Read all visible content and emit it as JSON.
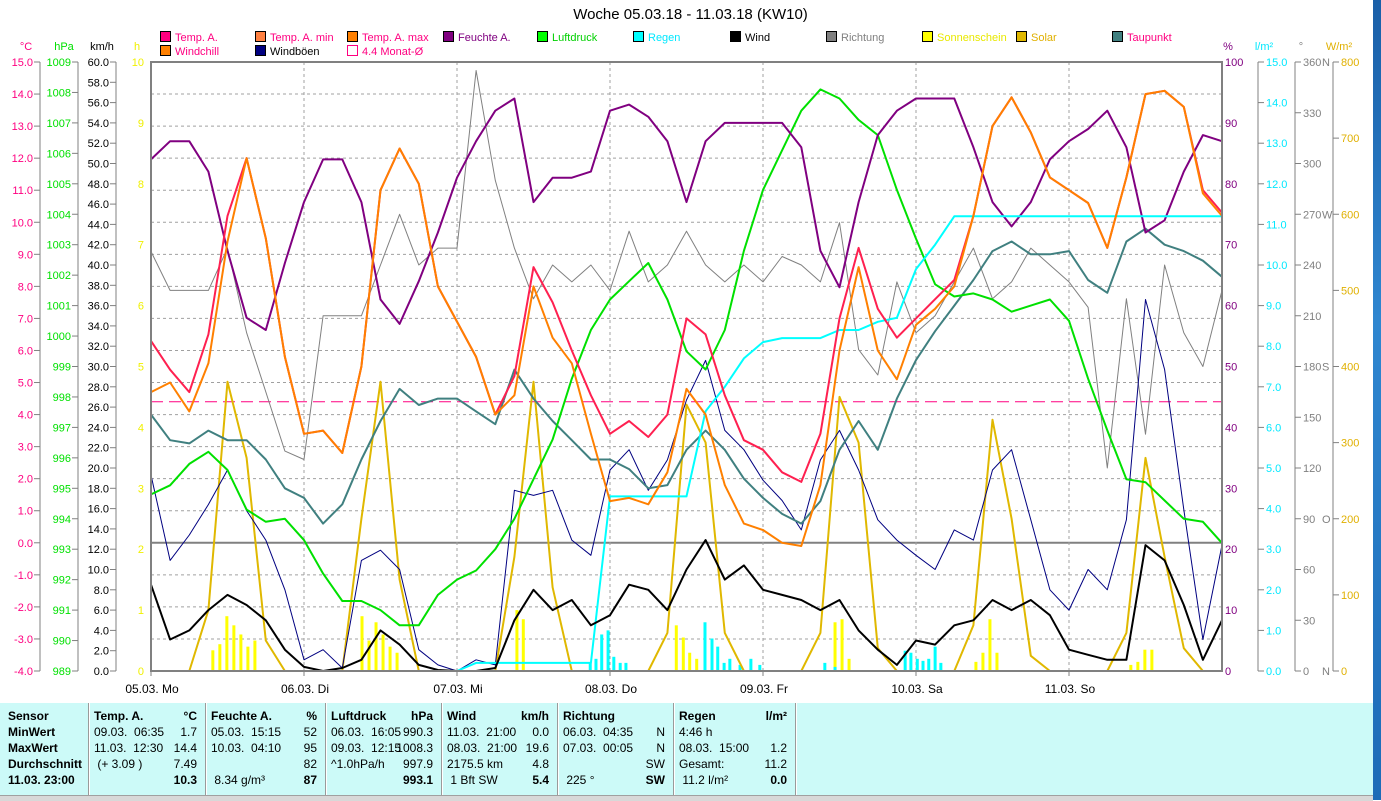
{
  "title": "Woche 05.03.18 - 11.03.18 (KW10)",
  "legend": [
    {
      "label": "Temp. A.",
      "swatch": "#ff0080",
      "text_color": "#ff0080"
    },
    {
      "label": "Temp. A. min",
      "swatch": "#ff8040",
      "text_color": "#ff0080"
    },
    {
      "label": "Temp. A. max",
      "swatch": "#ff8000",
      "text_color": "#ff0080"
    },
    {
      "label": "Feuchte A.",
      "swatch": "#800080",
      "text_color": "#800080"
    },
    {
      "label": "Luftdruck",
      "swatch": "#00ff00",
      "text_color": "#00d000"
    },
    {
      "label": "Regen",
      "swatch": "#00ffff",
      "text_color": "#00e8ff"
    },
    {
      "label": "Wind",
      "swatch": "#000000",
      "text_color": "#000000"
    },
    {
      "label": "Richtung",
      "swatch": "#808080",
      "text_color": "#808080"
    },
    {
      "label": "Sonnenschein",
      "swatch": "#ffff00",
      "text_color": "#e8e800"
    },
    {
      "label": "Solar",
      "swatch": "#e0b800",
      "text_color": "#e0b000"
    },
    {
      "label": "Taupunkt",
      "swatch": "#408080",
      "text_color": "#ff0080"
    },
    {
      "label": "Windchill",
      "swatch": "#ff8000",
      "text_color": "#ff0080"
    },
    {
      "label": "Windböen",
      "swatch": "#000080",
      "text_color": "#000000"
    },
    {
      "label": "4.4 Monat-Ø",
      "swatch": "outline",
      "text_color": "#ff0080"
    }
  ],
  "chart_data": {
    "type": "line",
    "title": "Woche 05.03.18 - 11.03.18 (KW10)",
    "x_start": "05.03.18 00:00",
    "x_step_hours": 3,
    "x_range_hours": [
      0,
      168
    ],
    "x_tick_labels": [
      "05.03.  Mo",
      "06.03.  Di",
      "07.03.  Mi",
      "08.03.  Do",
      "09.03.  Fr",
      "10.03.  Sa",
      "11.03.  So"
    ],
    "grid": true,
    "axes_left": [
      {
        "id": "temp",
        "unit": "°C",
        "min": -4,
        "max": 15,
        "step": 1,
        "decimals": 1,
        "color": "#ff0080"
      },
      {
        "id": "press",
        "unit": "hPa",
        "min": 989,
        "max": 1009,
        "step": 1,
        "decimals": 0,
        "color": "#00e000"
      },
      {
        "id": "wind",
        "unit": "km/h",
        "min": 0,
        "max": 60,
        "step": 2,
        "decimals": 1,
        "color": "#000000"
      },
      {
        "id": "sun",
        "unit": "h",
        "min": 0,
        "max": 10,
        "step": 1,
        "decimals": 0,
        "color": "#f0f000"
      }
    ],
    "axes_right": [
      {
        "id": "hum",
        "unit": "%",
        "min": 0,
        "max": 100,
        "step": 10,
        "decimals": 0,
        "color": "#800080"
      },
      {
        "id": "rain",
        "unit": "l/m²",
        "min": 0,
        "max": 15,
        "step": 1,
        "decimals": 1,
        "color": "#00e8ff"
      },
      {
        "id": "dir",
        "unit": "°",
        "min": 0,
        "max": 360,
        "step": 30,
        "decimals": 0,
        "color": "#808080",
        "compass": {
          "0": "N",
          "90": "O",
          "180": "S",
          "270": "W",
          "360": "N"
        }
      },
      {
        "id": "solar",
        "unit": "W/m²",
        "min": 0,
        "max": 800,
        "step": 100,
        "decimals": 0,
        "color": "#e0b000"
      }
    ],
    "reference_lines": [
      {
        "name": "4.4 Monat-Ø",
        "axis": "temp",
        "value": 4.4,
        "color": "#ff0080"
      }
    ],
    "series": [
      {
        "name": "Richtung",
        "axis": "dir",
        "color": "#808080",
        "width": 1,
        "values": [
          248,
          225,
          225,
          225,
          250,
          200,
          165,
          130,
          125,
          210,
          210,
          210,
          240,
          270,
          240,
          250,
          250,
          355,
          290,
          250,
          220,
          240,
          230,
          240,
          225,
          260,
          230,
          240,
          260,
          240,
          230,
          240,
          230,
          245,
          240,
          230,
          265,
          190,
          175,
          230,
          200,
          210,
          230,
          250,
          220,
          230,
          250,
          240,
          230,
          215,
          120,
          220,
          140,
          240,
          200,
          180,
          225
        ]
      },
      {
        "name": "Solar",
        "axis": "solar",
        "color": "#e0b800",
        "width": 2,
        "values": [
          0,
          0,
          0,
          80,
          380,
          280,
          40,
          0,
          0,
          0,
          0,
          200,
          380,
          120,
          0,
          0,
          0,
          0,
          0,
          150,
          380,
          110,
          0,
          0,
          0,
          0,
          0,
          50,
          350,
          300,
          50,
          0,
          0,
          0,
          0,
          50,
          360,
          300,
          30,
          0,
          0,
          0,
          0,
          60,
          330,
          200,
          20,
          0,
          0,
          0,
          0,
          50,
          280,
          150,
          30,
          0,
          0
        ]
      },
      {
        "name": "Windböen",
        "axis": "wind",
        "color": "#000080",
        "width": 1,
        "values": [
          19.3,
          10.9,
          13.4,
          16.4,
          19.8,
          15.8,
          12.9,
          8.0,
          1.1,
          2.1,
          0.3,
          10.9,
          11.9,
          10.0,
          2.1,
          0.6,
          0,
          1.1,
          0.6,
          17.8,
          17.3,
          17.8,
          12.9,
          11.4,
          19.8,
          21.8,
          17.8,
          20.8,
          26.7,
          30.6,
          23.7,
          21.8,
          18.8,
          16.8,
          13.9,
          20.8,
          23.7,
          19.8,
          14.9,
          12.9,
          11.4,
          10.0,
          13.9,
          12.9,
          19.8,
          21.8,
          14.9,
          8.0,
          6.0,
          10.0,
          8.0,
          14.9,
          36.6,
          29.7,
          15.9,
          3.1,
          12.4
        ]
      },
      {
        "name": "Taupunkt",
        "axis": "temp",
        "color": "#408080",
        "width": 2,
        "values": [
          4.0,
          3.2,
          3.1,
          3.5,
          3.2,
          3.2,
          2.6,
          1.7,
          1.4,
          0.6,
          1.2,
          2.6,
          3.8,
          4.8,
          4.3,
          4.5,
          4.5,
          4.1,
          3.7,
          5.4,
          4.5,
          3.8,
          3.2,
          2.6,
          2.6,
          2.3,
          1.7,
          1.8,
          2.9,
          3.5,
          2.9,
          2.0,
          1.4,
          0.9,
          0.6,
          1.3,
          2.9,
          3.8,
          2.9,
          4.5,
          5.7,
          6.6,
          7.4,
          8.2,
          9.1,
          9.4,
          9.0,
          9.0,
          9.1,
          8.2,
          7.8,
          9.4,
          9.8,
          9.3,
          9.1,
          8.8,
          8.3
        ]
      },
      {
        "name": "Luftdruck",
        "axis": "press",
        "color": "#00e000",
        "width": 2,
        "values": [
          994.8,
          995.1,
          995.8,
          996.2,
          995.6,
          994.3,
          993.9,
          994.0,
          993.3,
          992.2,
          991.3,
          991.3,
          991.0,
          990.5,
          990.5,
          991.5,
          992.0,
          992.3,
          993.0,
          994.0,
          995.3,
          996.6,
          998.6,
          1000.2,
          1001.2,
          1001.8,
          1002.4,
          1001.2,
          999.5,
          998.9,
          1000.2,
          1002.8,
          1004.8,
          1006.1,
          1007.4,
          1008.1,
          1007.8,
          1007.1,
          1006.6,
          1004.8,
          1003.2,
          1001.7,
          1001.3,
          1001.4,
          1001.2,
          1000.8,
          1001.0,
          1001.2,
          1000.5,
          998.6,
          996.9,
          995.3,
          995.2,
          994.6,
          994.0,
          993.9,
          993.2
        ]
      },
      {
        "name": "Feuchte A.",
        "axis": "hum",
        "color": "#800080",
        "width": 2,
        "values": [
          84,
          87,
          87,
          82,
          69,
          58,
          56,
          67,
          77,
          84,
          84,
          77,
          61,
          57,
          64,
          72,
          81,
          87,
          92,
          94,
          77,
          81,
          81,
          82,
          92,
          93,
          91,
          87,
          77,
          87,
          90,
          90,
          90,
          90,
          86,
          69,
          63,
          77,
          88,
          92,
          94,
          94,
          94,
          86,
          77,
          73,
          77,
          84,
          87,
          89,
          92,
          86,
          72,
          74,
          82,
          88,
          87
        ]
      },
      {
        "name": "Regen",
        "axis": "rain",
        "color": "#00ffff",
        "width": 2,
        "values": [
          0,
          0,
          0,
          0,
          0,
          0,
          0,
          0,
          0,
          0,
          0,
          0,
          0,
          0,
          0,
          0,
          0,
          0.2,
          0.2,
          0.2,
          0.2,
          0.2,
          0.2,
          0.2,
          4.3,
          4.3,
          4.3,
          4.3,
          4.3,
          6.4,
          7.0,
          7.7,
          8.1,
          8.2,
          8.2,
          8.2,
          8.4,
          8.4,
          8.6,
          8.7,
          9.9,
          10.5,
          11.2,
          11.2,
          11.2,
          11.2,
          11.2,
          11.2,
          11.2,
          11.2,
          11.2,
          11.2,
          11.2,
          11.2,
          11.2,
          11.2,
          11.2
        ]
      },
      {
        "name": "Temp. A.",
        "axis": "temp",
        "color": "#ff2050",
        "width": 2,
        "values": [
          6.3,
          5.4,
          4.7,
          6.5,
          10.2,
          12.0,
          9.5,
          5.8,
          3.4,
          3.5,
          2.8,
          5.5,
          11.0,
          12.3,
          11.2,
          8.0,
          6.9,
          5.8,
          4.0,
          5.2,
          8.6,
          7.5,
          6.0,
          4.6,
          3.4,
          3.8,
          3.3,
          4.0,
          7.0,
          6.5,
          4.6,
          3.2,
          2.9,
          2.2,
          1.9,
          3.4,
          7.0,
          9.2,
          7.3,
          6.4,
          7.0,
          7.6,
          8.2,
          10.2,
          13.0,
          13.9,
          12.8,
          11.4,
          11.0,
          10.6,
          9.2,
          11.4,
          14.0,
          14.1,
          13.6,
          11.0,
          10.3
        ]
      },
      {
        "name": "Windchill",
        "axis": "temp",
        "color": "#ff8000",
        "width": 2,
        "values": [
          4.7,
          5.0,
          4.1,
          5.6,
          9.4,
          12.0,
          9.5,
          5.8,
          3.4,
          3.5,
          2.8,
          5.5,
          11.0,
          12.3,
          11.2,
          8.0,
          6.9,
          5.8,
          4.0,
          4.6,
          8.0,
          6.4,
          5.6,
          3.4,
          1.3,
          1.4,
          1.2,
          2.2,
          4.8,
          4.0,
          1.8,
          0.6,
          0.4,
          0.0,
          -0.1,
          1.8,
          6.0,
          8.6,
          6.0,
          5.1,
          6.8,
          7.3,
          8.0,
          10.2,
          13.0,
          13.9,
          12.8,
          11.4,
          11.0,
          10.6,
          9.2,
          11.4,
          14.0,
          14.1,
          13.6,
          10.9,
          10.2
        ]
      },
      {
        "name": "Wind",
        "axis": "wind",
        "color": "#000000",
        "width": 2,
        "values": [
          8.5,
          3.1,
          4.0,
          6.0,
          7.5,
          6.5,
          5.0,
          2.1,
          0.4,
          0,
          0.3,
          1.1,
          4.0,
          2.6,
          0.6,
          0.1,
          0,
          0,
          0.3,
          5.0,
          8.0,
          6.0,
          7.0,
          4.5,
          5.5,
          8.5,
          8.0,
          6.0,
          10.0,
          12.9,
          9.0,
          10.4,
          8.0,
          7.5,
          7.0,
          6.0,
          7.0,
          4.0,
          2.1,
          0.6,
          3.0,
          2.6,
          4.5,
          5.0,
          7.0,
          6.0,
          7.0,
          5.5,
          2.1,
          1.6,
          1.1,
          1.1,
          12.4,
          10.9,
          6.5,
          1.1,
          5.0
        ]
      }
    ],
    "bars": [
      {
        "name": "Sonnenschein",
        "axis": "sun",
        "color": "#ffff00",
        "points": [
          [
            9.7,
            0.34
          ],
          [
            10.8,
            0.44
          ],
          [
            11.9,
            0.9
          ],
          [
            13.0,
            0.75
          ],
          [
            14.1,
            0.6
          ],
          [
            15.2,
            0.4
          ],
          [
            16.3,
            0.5
          ],
          [
            33.1,
            0.9
          ],
          [
            34.2,
            0.5
          ],
          [
            35.3,
            0.8
          ],
          [
            36.4,
            0.6
          ],
          [
            37.5,
            0.4
          ],
          [
            38.6,
            0.3
          ],
          [
            57.4,
            1.0
          ],
          [
            58.4,
            0.85
          ],
          [
            82.4,
            0.75
          ],
          [
            83.5,
            0.55
          ],
          [
            84.5,
            0.3
          ],
          [
            85.6,
            0.2
          ],
          [
            107.3,
            0.8
          ],
          [
            108.4,
            0.85
          ],
          [
            109.5,
            0.2
          ],
          [
            129.4,
            0.15
          ],
          [
            130.5,
            0.3
          ],
          [
            131.6,
            0.85
          ],
          [
            132.7,
            0.3
          ],
          [
            153.7,
            0.1
          ],
          [
            154.8,
            0.15
          ],
          [
            155.9,
            0.35
          ],
          [
            157.0,
            0.35
          ]
        ]
      },
      {
        "name": "Regen",
        "axis": "rain",
        "color": "#00ffff",
        "points": [
          [
            68.9,
            0.2
          ],
          [
            69.8,
            0.3
          ],
          [
            70.7,
            0.9
          ],
          [
            71.7,
            1.0
          ],
          [
            72.6,
            0.35
          ],
          [
            73.6,
            0.2
          ],
          [
            74.5,
            0.2
          ],
          [
            86.9,
            1.2
          ],
          [
            88.0,
            0.8
          ],
          [
            88.9,
            0.6
          ],
          [
            89.9,
            0.2
          ],
          [
            90.8,
            0.3
          ],
          [
            92.4,
            0.15
          ],
          [
            94.1,
            0.3
          ],
          [
            95.5,
            0.15
          ],
          [
            105.7,
            0.2
          ],
          [
            107.3,
            0.1
          ],
          [
            118.3,
            0.5
          ],
          [
            119.2,
            0.45
          ],
          [
            120.2,
            0.3
          ],
          [
            121.1,
            0.25
          ],
          [
            122.0,
            0.3
          ],
          [
            123.0,
            0.6
          ],
          [
            123.9,
            0.2
          ]
        ]
      }
    ]
  },
  "stats": {
    "sensor": [
      "Sensor",
      "MinWert",
      "MaxWert",
      "Durchschnitt",
      "11.03.  23:00"
    ],
    "columns": [
      {
        "title": "Temp. A.",
        "unit": "°C",
        "rows": [
          [
            "09.03.  06:35",
            "1.7"
          ],
          [
            "11.03.  12:30",
            "14.4"
          ],
          [
            " (+ 3.09 )",
            "7.49"
          ],
          [
            "",
            "10.3"
          ]
        ]
      },
      {
        "title": "Feuchte A.",
        "unit": "%",
        "rows": [
          [
            "05.03.  15:15",
            "52"
          ],
          [
            "10.03.  04:10",
            "95"
          ],
          [
            "",
            "82"
          ],
          [
            " 8.34 g/m³",
            "87"
          ]
        ]
      },
      {
        "title": "Luftdruck",
        "unit": "hPa",
        "rows": [
          [
            "06.03.  16:05",
            "990.3"
          ],
          [
            "09.03.  12:15",
            "1008.3"
          ],
          [
            "^1.0hPa/h",
            "997.9"
          ],
          [
            "",
            "993.1"
          ]
        ]
      },
      {
        "title": "Wind",
        "unit": "km/h",
        "rows": [
          [
            "11.03.  21:00",
            "0.0"
          ],
          [
            "08.03.  21:00",
            "19.6"
          ],
          [
            "2175.5 km",
            "4.8"
          ],
          [
            " 1 Bft SW",
            "5.4"
          ]
        ]
      },
      {
        "title": "Richtung",
        "unit": "",
        "rows": [
          [
            "06.03.  04:35",
            "N"
          ],
          [
            "07.03.  00:05",
            "N"
          ],
          [
            "",
            "SW"
          ],
          [
            " 225 °",
            "SW"
          ]
        ]
      },
      {
        "title": "Regen",
        "unit": "l/m²",
        "rows": [
          [
            "4:46 h",
            ""
          ],
          [
            "08.03.  15:00",
            "1.2"
          ],
          [
            "Gesamt:",
            "11.2"
          ],
          [
            " 11.2 l/m²",
            "0.0"
          ]
        ]
      }
    ]
  }
}
